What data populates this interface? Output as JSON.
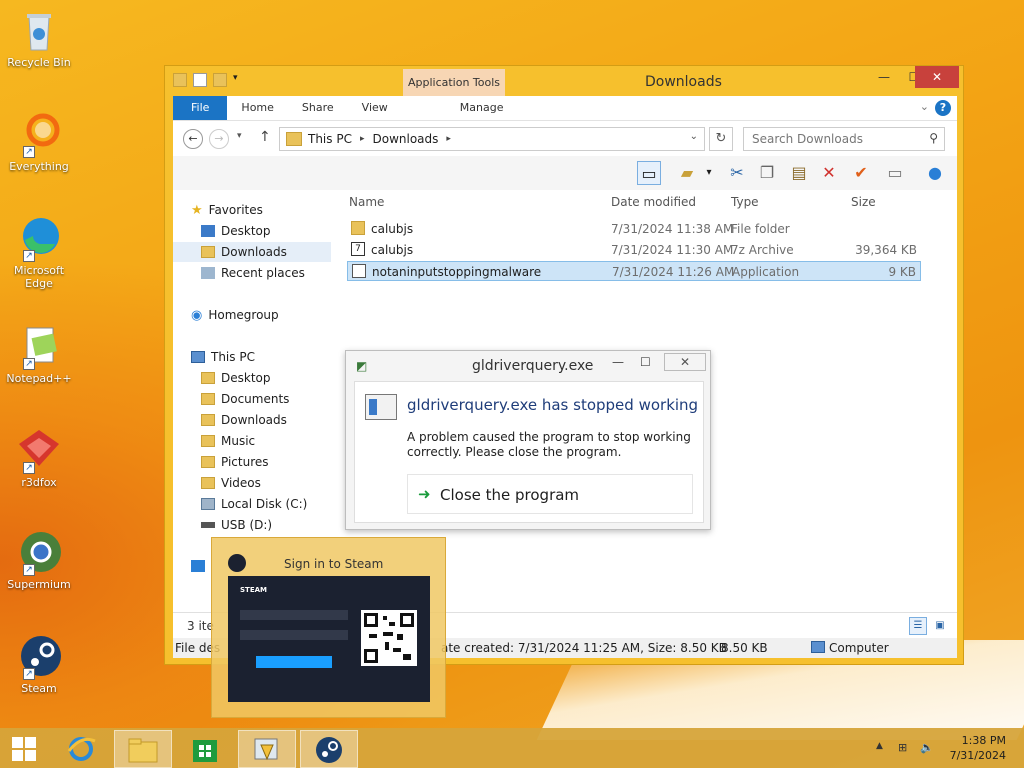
{
  "desktop": {
    "icons": [
      {
        "label": "Recycle Bin",
        "icon": "recycle-bin-icon"
      },
      {
        "label": "Everything",
        "icon": "everything-search-icon"
      },
      {
        "label": "Microsoft Edge",
        "icon": "edge-icon"
      },
      {
        "label": "Notepad++",
        "icon": "notepad-plus-plus-icon"
      },
      {
        "label": "r3dfox",
        "icon": "r3dfox-icon"
      },
      {
        "label": "Supermium",
        "icon": "supermium-icon"
      },
      {
        "label": "Steam",
        "icon": "steam-icon"
      }
    ]
  },
  "explorer": {
    "title": "Downloads",
    "context_tab": "Application Tools",
    "tabs": {
      "file": "File",
      "home": "Home",
      "share": "Share",
      "view": "View",
      "manage": "Manage"
    },
    "address": {
      "crumb1": "This PC",
      "crumb2": "Downloads"
    },
    "search_placeholder": "Search Downloads",
    "nav": {
      "favorites": "Favorites",
      "desktop": "Desktop",
      "downloads": "Downloads",
      "recent": "Recent places",
      "homegroup": "Homegroup",
      "thispc": "This PC",
      "pc_desktop": "Desktop",
      "pc_documents": "Documents",
      "pc_downloads": "Downloads",
      "pc_music": "Music",
      "pc_pictures": "Pictures",
      "pc_videos": "Videos",
      "local_disk": "Local Disk (C:)",
      "usb": "USB (D:)"
    },
    "columns": {
      "name": "Name",
      "date": "Date modified",
      "type": "Type",
      "size": "Size"
    },
    "files": [
      {
        "name": "calubjs",
        "date": "7/31/2024 11:38 AM",
        "type": "File folder",
        "size": ""
      },
      {
        "name": "calubjs",
        "date": "7/31/2024 11:30 AM",
        "type": "7z Archive",
        "size": "39,364 KB"
      },
      {
        "name": "notaninputstoppingmalware",
        "date": "7/31/2024 11:26 AM",
        "type": "Application",
        "size": "9 KB"
      }
    ],
    "status": {
      "items": "3 ite",
      "details_prefix": "File des",
      "details": "ate created: 7/31/2024 11:25 AM, Size: 8.50 KB",
      "size": "8.50 KB",
      "location": "Computer"
    }
  },
  "dialog": {
    "title": "gldriverquery.exe",
    "heading": "gldriverquery.exe has stopped working",
    "text": "A problem caused the program to stop working correctly. Please close the program.",
    "action": "Close the program"
  },
  "steam_preview": {
    "caption": "Sign in to Steam",
    "brand": "STEAM"
  },
  "taskbar": {
    "time": "1:38 PM",
    "date": "7/31/2024"
  },
  "colors": {
    "accent": "#1b74c5",
    "selection": "#cde4f7",
    "window_frame": "#f6c02d"
  }
}
